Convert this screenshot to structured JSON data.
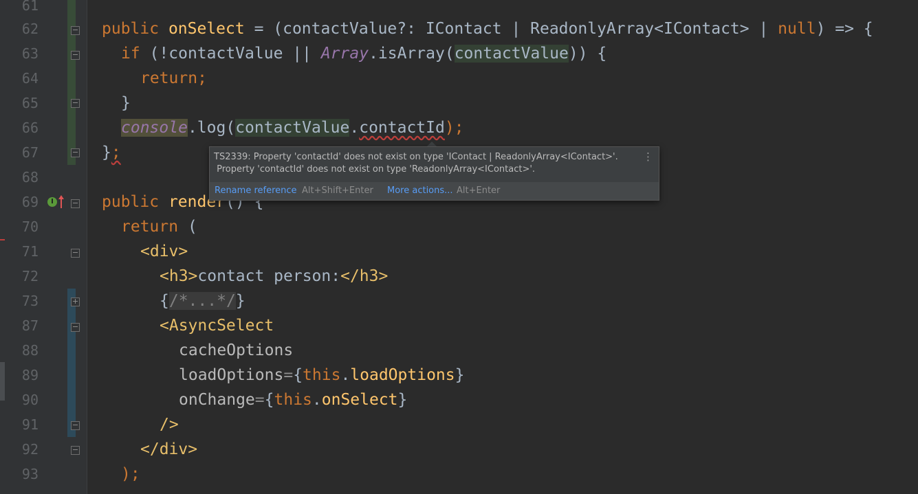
{
  "gutter": {
    "line_numbers": [
      "61",
      "62",
      "63",
      "64",
      "65",
      "66",
      "67",
      "68",
      "69",
      "70",
      "71",
      "72",
      "73",
      "87",
      "88",
      "89",
      "90",
      "91",
      "92",
      "93"
    ]
  },
  "code": {
    "l62": {
      "kw1": "public ",
      "fn": "onSelect",
      "t1": " = (contactValue?: IContact | ReadonlyArray<IContact> | ",
      "kw2": "null",
      "t2": ") => {"
    },
    "l63": {
      "kw": "if",
      "t1": " (!contactValue || ",
      "glob": "Array",
      "t2": ".isArray(",
      "hl": "contactValue",
      "t3": ")) {"
    },
    "l64": {
      "kw": "return;"
    },
    "l65": {
      "t": "}"
    },
    "l66": {
      "glob": "console",
      "t1": ".log(",
      "hl": "contactValue",
      "t2": ".",
      "prop": "contactId",
      "t3": ");"
    },
    "l67": {
      "t": "}",
      "warn": ";"
    },
    "l69": {
      "kw": "public ",
      "fn": "render",
      "t": "() {"
    },
    "l70": {
      "kw": "return",
      "t": " ("
    },
    "l71": {
      "tag": "<div>"
    },
    "l72": {
      "tag1": "<h3>",
      "t": "contact person:",
      "tag2": "</h3>"
    },
    "l73": {
      "t1": "{",
      "fold": "/*...*/",
      "t2": "}"
    },
    "l87": {
      "tag": "<AsyncSelect"
    },
    "l88": {
      "attr": "cacheOptions"
    },
    "l89": {
      "attr": "loadOptions",
      "eq": "=",
      "t1": "{",
      "kw": "this",
      "t2": ".",
      "fn": "loadOptions",
      "t3": "}"
    },
    "l90": {
      "attr": "onChange",
      "eq": "=",
      "t1": "{",
      "kw": "this",
      "t2": ".",
      "fn": "onSelect",
      "t3": "}"
    },
    "l91": {
      "tag": "/>"
    },
    "l92": {
      "tag": "</div>"
    },
    "l93": {
      "t": ");"
    }
  },
  "popup": {
    "line1": "TS2339: Property 'contactId' does not exist on type 'IContact | ReadonlyArray<IContact>'.",
    "line2": " Property 'contactId' does not exist on type 'ReadonlyArray<IContact>'.",
    "menu_icon": "⋮",
    "action1_label": "Rename reference",
    "action1_shortcut": "Alt+Shift+Enter",
    "action2_label": "More actions...",
    "action2_shortcut": "Alt+Enter"
  },
  "icons": {
    "override": "override-icon",
    "override_glyph": "I"
  },
  "colors": {
    "background": "#2b2b2b",
    "keyword": "#cc7832",
    "function": "#ffc66d",
    "error": "#bc3f3c",
    "link": "#589df6"
  }
}
